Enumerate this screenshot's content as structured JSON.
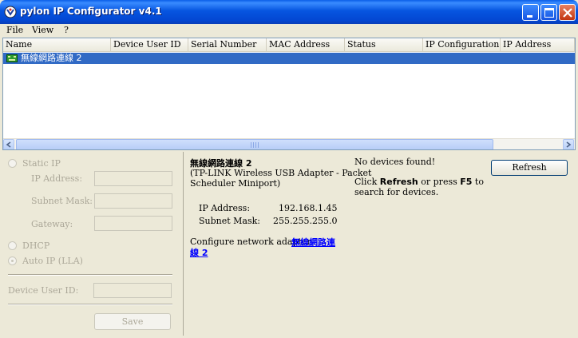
{
  "window": {
    "title": "pylon IP Configurator v4.1"
  },
  "menu": {
    "items": [
      "File",
      "View",
      "?"
    ]
  },
  "table": {
    "columns": [
      "Name",
      "Device User ID",
      "Serial Number",
      "MAC Address",
      "Status",
      "IP Configuration",
      "IP Address"
    ],
    "rows": [
      {
        "name": "無線網路連線 2"
      }
    ]
  },
  "config_panel": {
    "static_ip_label": "Static IP",
    "ip_address_label": "IP Address:",
    "subnet_mask_label": "Subnet Mask:",
    "gateway_label": "Gateway:",
    "dhcp_label": "DHCP",
    "auto_ip_label": "Auto IP (LLA)",
    "device_user_id_label": "Device User ID:",
    "save_label": "Save",
    "ip_address_value": "",
    "subnet_mask_value": "",
    "gateway_value": "",
    "device_user_id_value": ""
  },
  "adapter_info": {
    "name": "無線網路連線 2",
    "description_line1": "(TP-LINK Wireless USB Adapter - Packet",
    "description_line2": "Scheduler Miniport)",
    "ip_label": "IP Address:",
    "ip_value": "192.168.1.45",
    "mask_label": "Subnet Mask:",
    "mask_value": "255.255.255.0",
    "configure_text": "Configure network adapter ",
    "configure_link_line1": "無線網路連",
    "configure_link_line2": "線 2"
  },
  "status": {
    "no_devices": "No devices found!",
    "hint_prefix": "Click ",
    "hint_refresh": "Refresh",
    "hint_middle": " or press ",
    "hint_key": "F5",
    "hint_suffix": " to",
    "hint_line2": "search for devices."
  },
  "buttons": {
    "refresh_label": "Refresh"
  }
}
